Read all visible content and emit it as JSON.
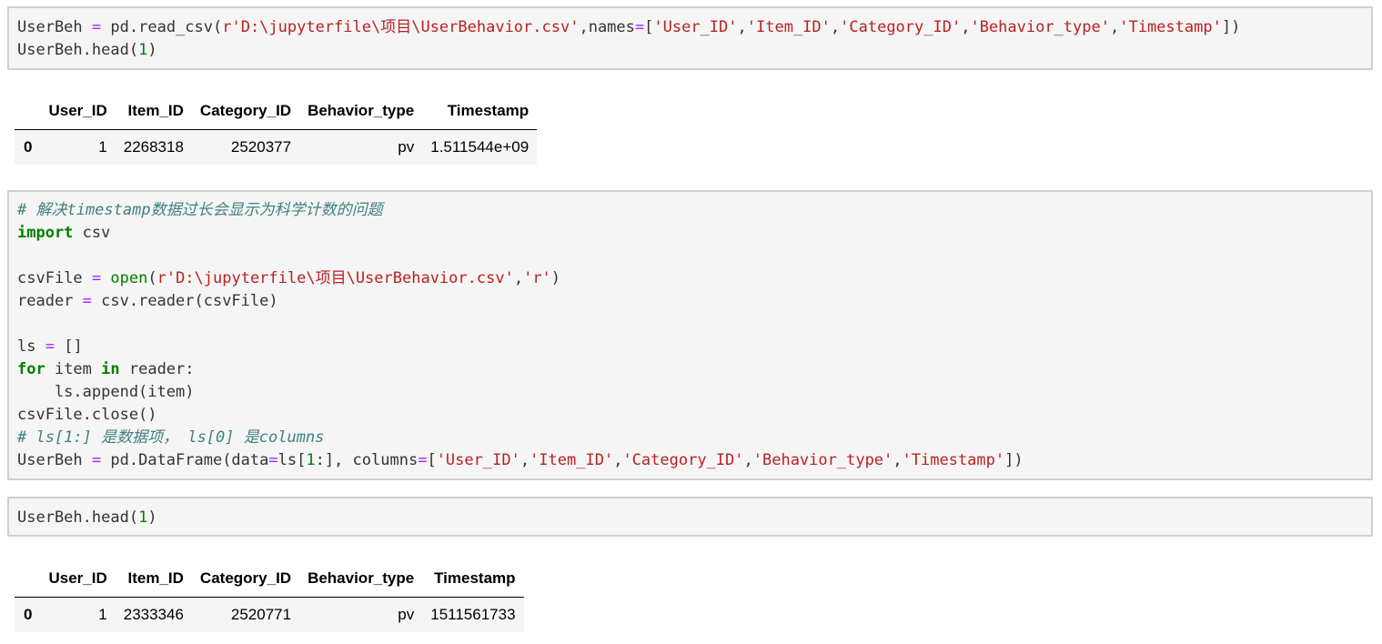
{
  "cell1": {
    "code": {
      "v1": "UserBeh",
      "eq": "=",
      "pd_read": "pd.read_csv(",
      "path": "r'D:\\jupyterfile\\项目\\UserBehavior.csv'",
      "names_kw": ",names",
      "open_br": "[",
      "c1": "'User_ID'",
      "c2": "'Item_ID'",
      "c3": "'Category_ID'",
      "c4": "'Behavior_type'",
      "c5": "'Timestamp'",
      "close": "])",
      "comma": ",",
      "line2_a": "UserBeh.head(",
      "line2_n": "1",
      "line2_b": ")"
    }
  },
  "table1": {
    "columns": [
      "",
      "User_ID",
      "Item_ID",
      "Category_ID",
      "Behavior_type",
      "Timestamp"
    ],
    "rows": [
      [
        "0",
        "1",
        "2268318",
        "2520377",
        "pv",
        "1.511544e+09"
      ]
    ]
  },
  "cell2": {
    "comment1": "# 解决timestamp数据过长会显示为科学计数的问题",
    "import_kw": "import",
    "import_mod": " csv",
    "l4_a": "csvFile ",
    "l4_eq": "=",
    "l4_open": "open",
    "l4_b": "(",
    "l4_path": "r'D:\\jupyterfile\\项目\\UserBehavior.csv'",
    "l4_c": ",",
    "l4_mode": "'r'",
    "l4_d": ")",
    "l5_a": "reader ",
    "l5_eq": "=",
    "l5_b": " csv.reader(csvFile)",
    "l7_a": "ls ",
    "l7_eq": "=",
    "l7_b": " []",
    "for_kw": "for",
    "l8_b": " item ",
    "in_kw": "in",
    "l8_c": " reader:",
    "l9": "    ls.append(item)",
    "l10": "csvFile.close()",
    "comment2": "# ls[1:] 是数据项， ls[0] 是columns",
    "l12_a": "UserBeh ",
    "l12_eq": "=",
    "l12_b": " pd.DataFrame(data",
    "l12_eq2": "=",
    "l12_c": "ls[",
    "l12_n": "1",
    "l12_d": ":], columns",
    "l12_eq3": "=",
    "l12_e": "[",
    "c1": "'User_ID'",
    "c2": "'Item_ID'",
    "c3": "'Category_ID'",
    "c4": "'Behavior_type'",
    "c5": "'Timestamp'",
    "comma": ",",
    "l12_f": "])"
  },
  "cell3": {
    "a": "UserBeh.head(",
    "n": "1",
    "b": ")"
  },
  "table2": {
    "columns": [
      "",
      "User_ID",
      "Item_ID",
      "Category_ID",
      "Behavior_type",
      "Timestamp"
    ],
    "rows": [
      [
        "0",
        "1",
        "2333346",
        "2520771",
        "pv",
        "1511561733"
      ]
    ]
  }
}
